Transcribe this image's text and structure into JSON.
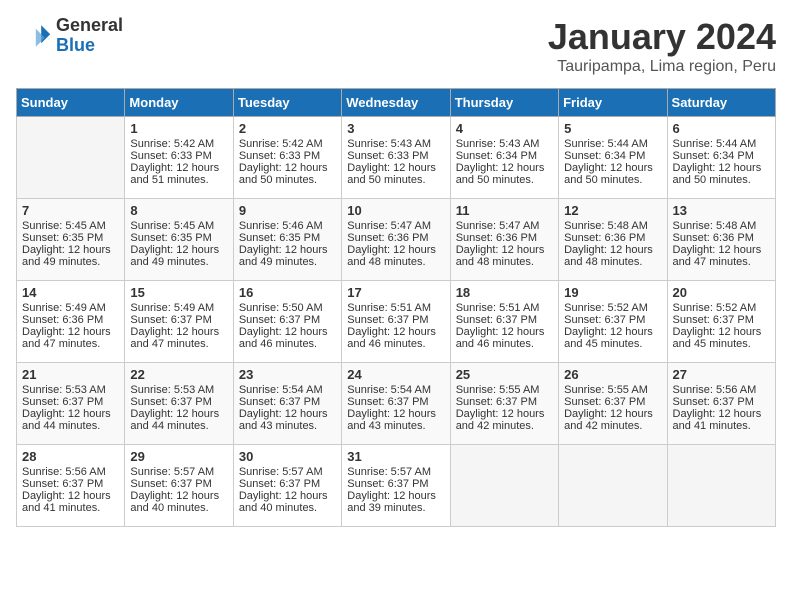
{
  "logo": {
    "general": "General",
    "blue": "Blue"
  },
  "title": "January 2024",
  "location": "Tauripampa, Lima region, Peru",
  "days_of_week": [
    "Sunday",
    "Monday",
    "Tuesday",
    "Wednesday",
    "Thursday",
    "Friday",
    "Saturday"
  ],
  "weeks": [
    [
      {
        "day": "",
        "info": ""
      },
      {
        "day": "1",
        "info": "Sunrise: 5:42 AM\nSunset: 6:33 PM\nDaylight: 12 hours\nand 51 minutes."
      },
      {
        "day": "2",
        "info": "Sunrise: 5:42 AM\nSunset: 6:33 PM\nDaylight: 12 hours\nand 50 minutes."
      },
      {
        "day": "3",
        "info": "Sunrise: 5:43 AM\nSunset: 6:33 PM\nDaylight: 12 hours\nand 50 minutes."
      },
      {
        "day": "4",
        "info": "Sunrise: 5:43 AM\nSunset: 6:34 PM\nDaylight: 12 hours\nand 50 minutes."
      },
      {
        "day": "5",
        "info": "Sunrise: 5:44 AM\nSunset: 6:34 PM\nDaylight: 12 hours\nand 50 minutes."
      },
      {
        "day": "6",
        "info": "Sunrise: 5:44 AM\nSunset: 6:34 PM\nDaylight: 12 hours\nand 50 minutes."
      }
    ],
    [
      {
        "day": "7",
        "info": "Sunrise: 5:45 AM\nSunset: 6:35 PM\nDaylight: 12 hours\nand 49 minutes."
      },
      {
        "day": "8",
        "info": "Sunrise: 5:45 AM\nSunset: 6:35 PM\nDaylight: 12 hours\nand 49 minutes."
      },
      {
        "day": "9",
        "info": "Sunrise: 5:46 AM\nSunset: 6:35 PM\nDaylight: 12 hours\nand 49 minutes."
      },
      {
        "day": "10",
        "info": "Sunrise: 5:47 AM\nSunset: 6:36 PM\nDaylight: 12 hours\nand 48 minutes."
      },
      {
        "day": "11",
        "info": "Sunrise: 5:47 AM\nSunset: 6:36 PM\nDaylight: 12 hours\nand 48 minutes."
      },
      {
        "day": "12",
        "info": "Sunrise: 5:48 AM\nSunset: 6:36 PM\nDaylight: 12 hours\nand 48 minutes."
      },
      {
        "day": "13",
        "info": "Sunrise: 5:48 AM\nSunset: 6:36 PM\nDaylight: 12 hours\nand 47 minutes."
      }
    ],
    [
      {
        "day": "14",
        "info": "Sunrise: 5:49 AM\nSunset: 6:36 PM\nDaylight: 12 hours\nand 47 minutes."
      },
      {
        "day": "15",
        "info": "Sunrise: 5:49 AM\nSunset: 6:37 PM\nDaylight: 12 hours\nand 47 minutes."
      },
      {
        "day": "16",
        "info": "Sunrise: 5:50 AM\nSunset: 6:37 PM\nDaylight: 12 hours\nand 46 minutes."
      },
      {
        "day": "17",
        "info": "Sunrise: 5:51 AM\nSunset: 6:37 PM\nDaylight: 12 hours\nand 46 minutes."
      },
      {
        "day": "18",
        "info": "Sunrise: 5:51 AM\nSunset: 6:37 PM\nDaylight: 12 hours\nand 46 minutes."
      },
      {
        "day": "19",
        "info": "Sunrise: 5:52 AM\nSunset: 6:37 PM\nDaylight: 12 hours\nand 45 minutes."
      },
      {
        "day": "20",
        "info": "Sunrise: 5:52 AM\nSunset: 6:37 PM\nDaylight: 12 hours\nand 45 minutes."
      }
    ],
    [
      {
        "day": "21",
        "info": "Sunrise: 5:53 AM\nSunset: 6:37 PM\nDaylight: 12 hours\nand 44 minutes."
      },
      {
        "day": "22",
        "info": "Sunrise: 5:53 AM\nSunset: 6:37 PM\nDaylight: 12 hours\nand 44 minutes."
      },
      {
        "day": "23",
        "info": "Sunrise: 5:54 AM\nSunset: 6:37 PM\nDaylight: 12 hours\nand 43 minutes."
      },
      {
        "day": "24",
        "info": "Sunrise: 5:54 AM\nSunset: 6:37 PM\nDaylight: 12 hours\nand 43 minutes."
      },
      {
        "day": "25",
        "info": "Sunrise: 5:55 AM\nSunset: 6:37 PM\nDaylight: 12 hours\nand 42 minutes."
      },
      {
        "day": "26",
        "info": "Sunrise: 5:55 AM\nSunset: 6:37 PM\nDaylight: 12 hours\nand 42 minutes."
      },
      {
        "day": "27",
        "info": "Sunrise: 5:56 AM\nSunset: 6:37 PM\nDaylight: 12 hours\nand 41 minutes."
      }
    ],
    [
      {
        "day": "28",
        "info": "Sunrise: 5:56 AM\nSunset: 6:37 PM\nDaylight: 12 hours\nand 41 minutes."
      },
      {
        "day": "29",
        "info": "Sunrise: 5:57 AM\nSunset: 6:37 PM\nDaylight: 12 hours\nand 40 minutes."
      },
      {
        "day": "30",
        "info": "Sunrise: 5:57 AM\nSunset: 6:37 PM\nDaylight: 12 hours\nand 40 minutes."
      },
      {
        "day": "31",
        "info": "Sunrise: 5:57 AM\nSunset: 6:37 PM\nDaylight: 12 hours\nand 39 minutes."
      },
      {
        "day": "",
        "info": ""
      },
      {
        "day": "",
        "info": ""
      },
      {
        "day": "",
        "info": ""
      }
    ]
  ]
}
